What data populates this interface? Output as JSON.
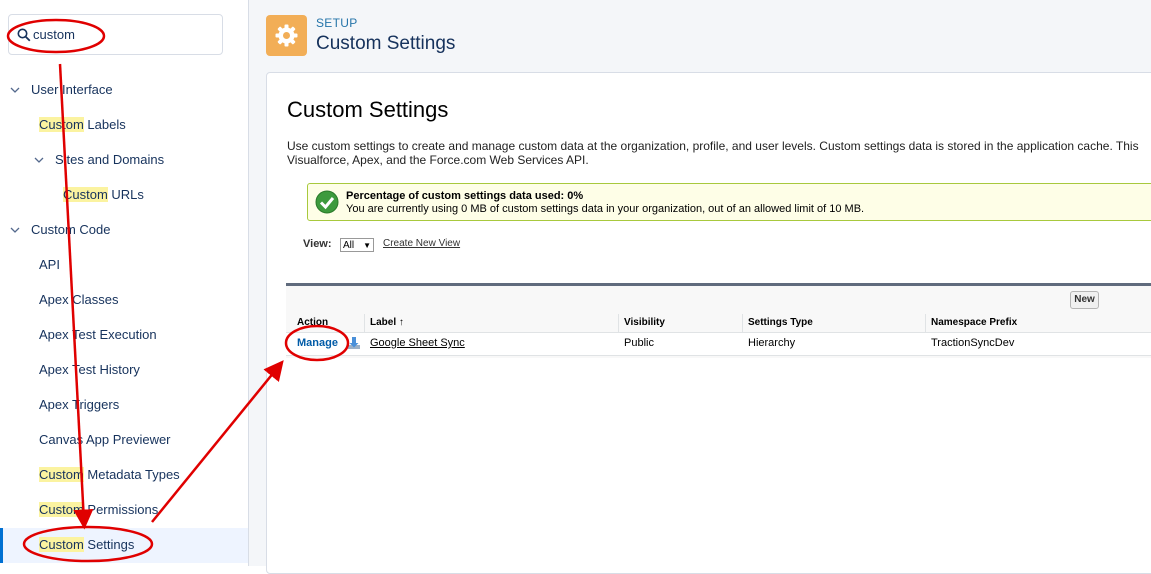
{
  "sidebar": {
    "search": {
      "value": "custom"
    },
    "items": [
      {
        "label": "User Interface",
        "level": 0,
        "expanded": true
      },
      {
        "label_hl": "Custom",
        "label_rest": " Labels",
        "level": 1
      },
      {
        "label": "Sites and Domains",
        "level": 1,
        "expanded": true
      },
      {
        "label_hl": "Custom",
        "label_rest": " URLs",
        "level": 2
      },
      {
        "label": "Custom Code",
        "level": 0,
        "expanded": true
      },
      {
        "label": "API",
        "level": 1
      },
      {
        "label": "Apex Classes",
        "level": 1
      },
      {
        "label": "Apex Test Execution",
        "level": 1
      },
      {
        "label": "Apex Test History",
        "level": 1
      },
      {
        "label": "Apex Triggers",
        "level": 1
      },
      {
        "label": "Canvas App Previewer",
        "level": 1
      },
      {
        "label_hl": "Custom",
        "label_rest": " Metadata Types",
        "level": 1
      },
      {
        "label_hl": "Custom",
        "label_rest": " Permissions",
        "level": 1
      },
      {
        "label_hl": "Custom",
        "label_rest": " Settings",
        "level": 1,
        "selected": true
      }
    ]
  },
  "header": {
    "setup_label": "SETUP",
    "title": "Custom Settings"
  },
  "content": {
    "heading": "Custom Settings",
    "description_line1": "Use custom settings to create and manage custom data at the organization, profile, and user levels. Custom settings data is stored in the application cache. This",
    "description_line2": "Visualforce, Apex, and the Force.com Web Services API.",
    "usage": {
      "title": "Percentage of custom settings data used: 0%",
      "detail": "You are currently using 0 MB of custom settings data in your organization, out of an allowed limit of 10 MB."
    },
    "view": {
      "label": "View:",
      "selected": "All",
      "create_new_view": "Create New View"
    },
    "table": {
      "new_button": "New",
      "columns": [
        "Action",
        "Label ↑",
        "Visibility",
        "Settings Type",
        "Namespace Prefix"
      ],
      "rows": [
        {
          "action": "Manage",
          "label": "Google Sheet Sync",
          "visibility": "Public",
          "settings_type": "Hierarchy",
          "namespace_prefix": "TractionSyncDev"
        }
      ]
    }
  },
  "colors": {
    "accent": "#0070d2",
    "highlight": "#fbf3a0",
    "setup_icon": "#f2ae57",
    "annotation": "#e00000"
  }
}
